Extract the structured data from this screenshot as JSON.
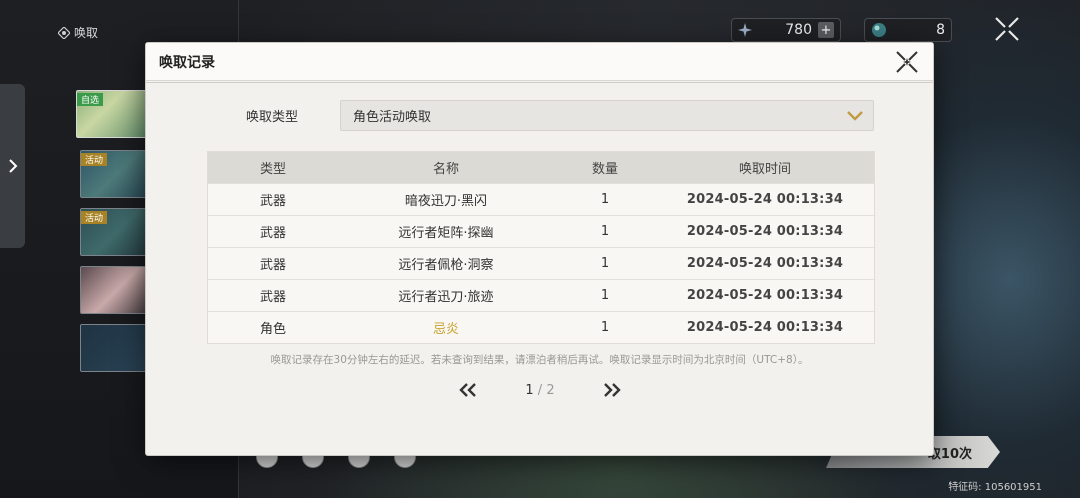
{
  "background": {
    "summon_label": "唤取",
    "banner_tags": [
      "自选",
      "活动",
      "活动"
    ],
    "currency_a": "780",
    "currency_b": "8",
    "bottom_button_label": "取10次",
    "footer_code": "特征码: 105601951"
  },
  "modal": {
    "title": "唤取记录",
    "type_label": "唤取类型",
    "type_value": "角色活动唤取",
    "columns": [
      "类型",
      "名称",
      "数量",
      "唤取时间"
    ],
    "rows": [
      {
        "type": "武器",
        "name": "暗夜迅刀·黑闪",
        "qty": "1",
        "time": "2024-05-24 00:13:34"
      },
      {
        "type": "武器",
        "name": "远行者矩阵·探幽",
        "qty": "1",
        "time": "2024-05-24 00:13:34"
      },
      {
        "type": "武器",
        "name": "远行者佩枪·洞察",
        "qty": "1",
        "time": "2024-05-24 00:13:34"
      },
      {
        "type": "武器",
        "name": "远行者迅刀·旅迹",
        "qty": "1",
        "time": "2024-05-24 00:13:34"
      },
      {
        "type": "角色",
        "name": "忌炎",
        "qty": "1",
        "time": "2024-05-24 00:13:34"
      }
    ],
    "notice": "唤取记录存在30分钟左右的延迟。若未查询到结果，请漂泊者稍后再试。唤取记录显示时间为北京时间（UTC+8）。",
    "pager": {
      "current": "1",
      "separator": "/",
      "total": "2"
    }
  },
  "colors": {
    "highlight": "#caa12a",
    "modal_bg": "#f2f1ee"
  },
  "icons": [
    "summon-icon",
    "chevron-right-icon",
    "star-currency-icon",
    "plus-icon",
    "orb-currency-icon",
    "close-x-icon",
    "chevron-down-icon",
    "double-chevron-left-icon",
    "double-chevron-right-icon"
  ]
}
